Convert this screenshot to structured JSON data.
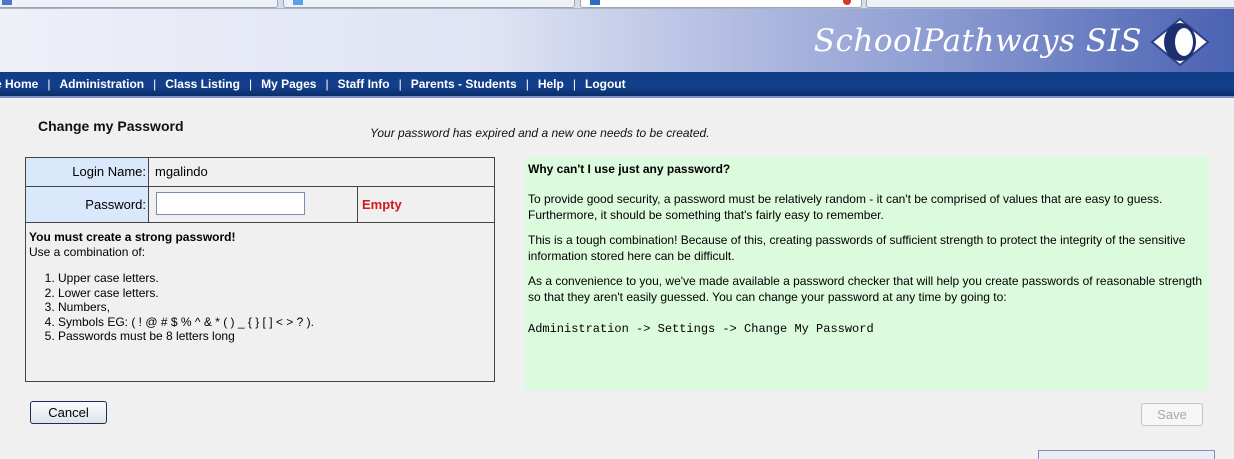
{
  "header": {
    "brand": "SchoolPathways SIS"
  },
  "nav": {
    "items": [
      "te Home",
      "Administration",
      "Class Listing",
      "My Pages",
      "Staff Info",
      "Parents - Students",
      "Help",
      "Logout"
    ],
    "separator": "|"
  },
  "page": {
    "title": "Change my Password",
    "expired_message": "Your password has expired and a new one needs to be created."
  },
  "form": {
    "login_label": "Login Name:",
    "login_value": "mgalindo",
    "password_label": "Password:",
    "password_value": "",
    "strength_status": "Empty",
    "strength_color": "#d21a1a"
  },
  "rules": {
    "title": "You must create a strong password!",
    "subtitle": "Use a combination of:",
    "items": [
      "Upper case letters.",
      "Lower case letters.",
      "Numbers,",
      "Symbols EG: ( ! @ # $ % ^ & * ( ) _ { } [ ] < > ? ).",
      "Passwords must be 8 letters long"
    ]
  },
  "help": {
    "title": "Why can't I use just any password?",
    "paragraphs": [
      "To provide good security, a password must be relatively random - it can't be comprised of values that are easy to guess. Furthermore, it should be something that's fairly easy to remember.",
      "This is a tough combination! Because of this, creating passwords of sufficient strength to protect the integrity of the sensitive information stored here can be difficult.",
      "As a convenience to you, we've made available a password checker that will help you create passwords of reasonable strength so that they aren't easily guessed. You can change your password at any time by going to:"
    ],
    "path": "Administration -> Settings -> Change My Password",
    "background": "#dcfadc"
  },
  "buttons": {
    "cancel": "Cancel",
    "save": "Save"
  },
  "colors": {
    "nav_bar": "#143f8c",
    "label_cell": "#d9e8fb"
  }
}
